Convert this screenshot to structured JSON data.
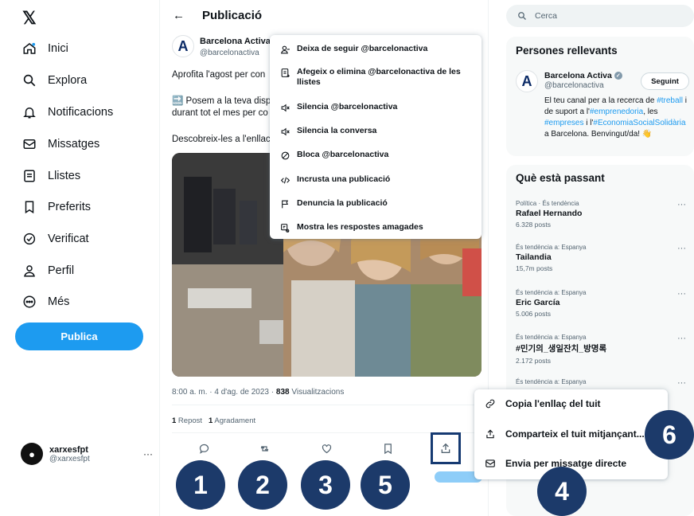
{
  "app": {
    "logo": "𝕏"
  },
  "sidebar": {
    "items": [
      {
        "label": "Inici",
        "icon": "home-icon"
      },
      {
        "label": "Explora",
        "icon": "search-icon"
      },
      {
        "label": "Notificacions",
        "icon": "bell-icon"
      },
      {
        "label": "Missatges",
        "icon": "mail-icon"
      },
      {
        "label": "Llistes",
        "icon": "list-icon"
      },
      {
        "label": "Preferits",
        "icon": "bookmark-icon"
      },
      {
        "label": "Verificat",
        "icon": "verified-icon"
      },
      {
        "label": "Perfil",
        "icon": "person-icon"
      },
      {
        "label": "Més",
        "icon": "more-circle-icon"
      }
    ],
    "publish_label": "Publica",
    "account": {
      "name": "xarxesfpt",
      "handle": "@xarxesfpt",
      "more": "···"
    }
  },
  "main": {
    "back": "←",
    "title": "Publicació",
    "post": {
      "author_name": "Barcelona Activa",
      "author_handle": "@barcelonactiva",
      "line1": "Aprofita l'agost per con",
      "line2_prefix": "🔜",
      "line2": " Posem a la teva disp",
      "line3": "durant tot el mes per co",
      "line4": "Descobreix-les a l'enllac",
      "meta_time": "8:00 a. m. · 4 d'ag. de 2023 · ",
      "meta_views": "838",
      "meta_views_label": " Visualitzacions",
      "reposts_count": "1",
      "reposts_label": " Repost",
      "likes_count": "1",
      "likes_label": " Agradament"
    }
  },
  "menu": {
    "items": [
      {
        "label": "Deixa de seguir @barcelonactiva",
        "icon": "unfollow-icon"
      },
      {
        "label": "Afegeix o elimina @barcelonactiva de les llistes",
        "icon": "list-add-icon"
      },
      {
        "label": "Silencia @barcelonactiva",
        "icon": "mute-icon"
      },
      {
        "label": "Silencia la conversa",
        "icon": "mute-conversation-icon"
      },
      {
        "label": "Bloca @barcelonactiva",
        "icon": "block-icon"
      },
      {
        "label": "Incrusta una publicació",
        "icon": "embed-icon"
      },
      {
        "label": "Denuncia la publicació",
        "icon": "flag-icon"
      },
      {
        "label": "Mostra les respostes amagades",
        "icon": "hidden-replies-icon"
      }
    ]
  },
  "right": {
    "search_placeholder": "Cerca",
    "relevant": {
      "title": "Persones rellevants",
      "name": "Barcelona Activa",
      "handle": "@barcelonactiva",
      "follow_label": "Seguint",
      "bio_1": "El teu canal per a la recerca de ",
      "bio_tag1": "#treball",
      "bio_2": " i de suport a l'",
      "bio_tag2": "#emprenedoria",
      "bio_3": ", les ",
      "bio_tag3": "#empreses",
      "bio_4": " i l'",
      "bio_tag4": "#EconomiaSocialSolidària",
      "bio_5": " a Barcelona. Benvingut/da! 👋"
    },
    "trends": {
      "title": "Què està passant",
      "items": [
        {
          "category": "Política · És tendència",
          "name": "Rafael Hernando",
          "count": "6.328 posts"
        },
        {
          "category": "És tendència a: Espanya",
          "name": "Tailandia",
          "count": "15,7m posts"
        },
        {
          "category": "És tendència a: Espanya",
          "name": "Eric García",
          "count": "5.006 posts"
        },
        {
          "category": "És tendència a: Espanya",
          "name": "#민기의_생일잔치_방명록",
          "count": "2.172 posts"
        },
        {
          "category": "És tendència a: Espanya",
          "name": "",
          "count": ""
        }
      ]
    }
  },
  "share_menu": {
    "items": [
      {
        "label": "Copia l'enllaç del tuit",
        "icon": "link-icon"
      },
      {
        "label": "Comparteix el tuit mitjançant...",
        "icon": "share-icon"
      },
      {
        "label": "Envia per missatge directe",
        "icon": "mail-icon"
      }
    ]
  },
  "badges": [
    "1",
    "2",
    "3",
    "5",
    "4",
    "6"
  ],
  "colors": {
    "accent": "#1d9bf0",
    "badge": "#1c3a6a"
  }
}
